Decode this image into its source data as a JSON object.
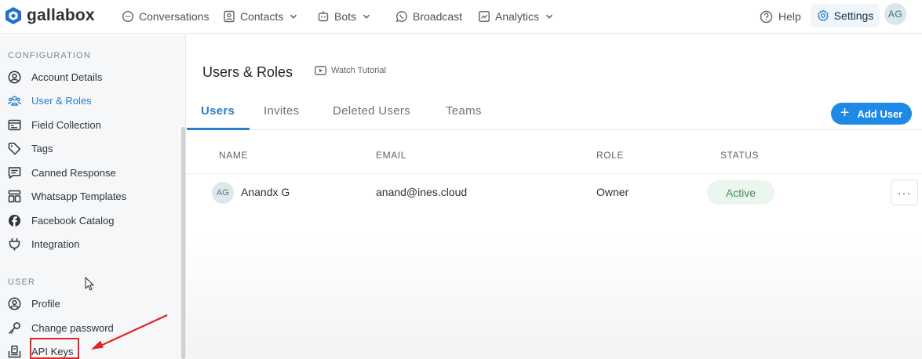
{
  "brand": {
    "name": "gallabox"
  },
  "nav": {
    "conversations": "Conversations",
    "contacts": "Contacts",
    "bots": "Bots",
    "broadcast": "Broadcast",
    "analytics": "Analytics",
    "help": "Help",
    "settings": "Settings",
    "user_initials": "AG"
  },
  "sidebar": {
    "configuration_label": "CONFIGURATION",
    "config_items": [
      {
        "label": "Account Details",
        "icon": "user-circle-icon"
      },
      {
        "label": "User & Roles",
        "icon": "users-icon",
        "active": true
      },
      {
        "label": "Field Collection",
        "icon": "id-card-icon"
      },
      {
        "label": "Tags",
        "icon": "tag-icon"
      },
      {
        "label": "Canned Response",
        "icon": "message-icon"
      },
      {
        "label": "Whatsapp Templates",
        "icon": "template-icon"
      },
      {
        "label": "Facebook Catalog",
        "icon": "facebook-icon"
      },
      {
        "label": "Integration",
        "icon": "plug-icon"
      }
    ],
    "user_label": "USER",
    "user_items": [
      {
        "label": "Profile",
        "icon": "user-circle-icon"
      },
      {
        "label": "Change password",
        "icon": "key-icon"
      },
      {
        "label": "API Keys",
        "icon": "api-key-icon"
      }
    ]
  },
  "main": {
    "title": "Users & Roles",
    "watch_tutorial": "Watch Tutorial",
    "tabs": [
      {
        "label": "Users",
        "active": true
      },
      {
        "label": "Invites"
      },
      {
        "label": "Deleted Users"
      },
      {
        "label": "Teams"
      }
    ],
    "add_user": "Add User",
    "table": {
      "columns": [
        "NAME",
        "EMAIL",
        "ROLE",
        "STATUS"
      ],
      "rows": [
        {
          "initials": "AG",
          "name": "Anandx G",
          "email": "anand@ines.cloud",
          "role": "Owner",
          "status": "Active"
        }
      ]
    },
    "more_label": "···"
  },
  "colors": {
    "accent": "#2a7ec7",
    "primary_button": "#1e8ae6",
    "active_status": "#3f8c5c",
    "highlight": "#e0242b"
  }
}
